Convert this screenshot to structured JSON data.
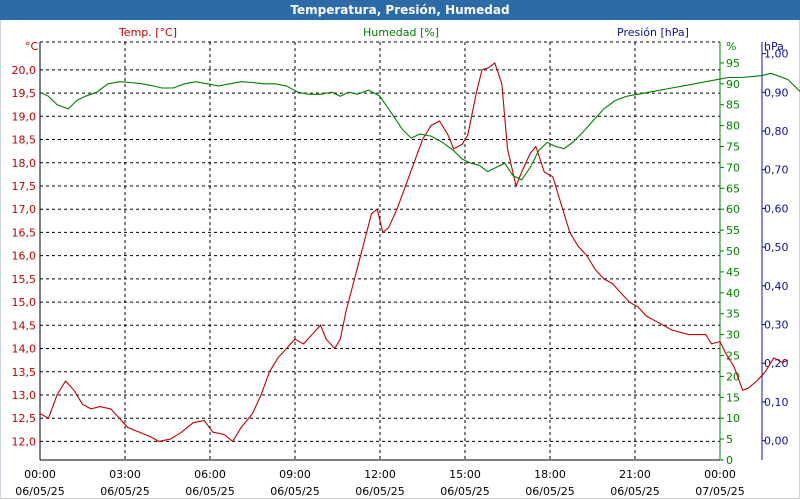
{
  "window": {
    "title": "Temperatura, Presión, Humedad"
  },
  "colors": {
    "temp": "#c00000",
    "hum": "#008000",
    "pres": "#1010a0",
    "grid": "#000000",
    "title_bg": "#2d6aa8"
  },
  "chart_data": {
    "type": "line",
    "grid": true,
    "x_ticks": [
      {
        "time": "00:00",
        "date": "06/05/25"
      },
      {
        "time": "03:00",
        "date": "06/05/25"
      },
      {
        "time": "06:00",
        "date": "06/05/25"
      },
      {
        "time": "09:00",
        "date": "06/05/25"
      },
      {
        "time": "12:00",
        "date": "06/05/25"
      },
      {
        "time": "15:00",
        "date": "06/05/25"
      },
      {
        "time": "18:00",
        "date": "06/05/25"
      },
      {
        "time": "21:00",
        "date": "06/05/25"
      },
      {
        "time": "00:00",
        "date": "07/05/25"
      }
    ],
    "x_range_hours": [
      0,
      24
    ],
    "axes": {
      "temp": {
        "unit": "°C",
        "ylim": [
          11.6,
          20.6
        ],
        "ticks": [
          "12,0",
          "12,5",
          "13,0",
          "13,5",
          "14,0",
          "14,5",
          "15,0",
          "15,5",
          "16,0",
          "16,5",
          "17,0",
          "17,5",
          "18,0",
          "18,5",
          "19,0",
          "19,5",
          "20,0"
        ]
      },
      "hum": {
        "unit": "%",
        "ylim": [
          0,
          100
        ],
        "ticks": [
          "0",
          "5",
          "10",
          "15",
          "20",
          "25",
          "30",
          "35",
          "40",
          "45",
          "50",
          "55",
          "60",
          "65",
          "70",
          "75",
          "80",
          "85",
          "90",
          "95"
        ]
      },
      "pres": {
        "unit": "hPa",
        "ylim": [
          -0.05,
          1.03
        ],
        "ticks": [
          "0,00",
          "0,10",
          "0,20",
          "0,30",
          "0,40",
          "0,50",
          "0,60",
          "0,70",
          "0,80",
          "0,90",
          "1,00"
        ]
      }
    },
    "legend": {
      "temp": "Temp. [°C]",
      "hum": "Humedad [%]",
      "pres": "Presión [hPa]"
    },
    "series": [
      {
        "name": "Temp. [°C]",
        "axis": "temp",
        "points": [
          [
            0,
            12.6
          ],
          [
            0.3,
            12.5
          ],
          [
            0.6,
            13.0
          ],
          [
            0.9,
            13.3
          ],
          [
            1.2,
            13.1
          ],
          [
            1.5,
            12.8
          ],
          [
            1.8,
            12.7
          ],
          [
            2.1,
            12.75
          ],
          [
            2.5,
            12.7
          ],
          [
            2.8,
            12.5
          ],
          [
            3.1,
            12.3
          ],
          [
            3.5,
            12.2
          ],
          [
            3.9,
            12.1
          ],
          [
            4.2,
            12.0
          ],
          [
            4.6,
            12.05
          ],
          [
            5.0,
            12.2
          ],
          [
            5.4,
            12.4
          ],
          [
            5.8,
            12.45
          ],
          [
            6.1,
            12.2
          ],
          [
            6.5,
            12.15
          ],
          [
            6.8,
            12.0
          ],
          [
            7.1,
            12.3
          ],
          [
            7.5,
            12.6
          ],
          [
            7.8,
            13.0
          ],
          [
            8.1,
            13.5
          ],
          [
            8.4,
            13.8
          ],
          [
            8.7,
            14.0
          ],
          [
            9.0,
            14.2
          ],
          [
            9.3,
            14.1
          ],
          [
            9.6,
            14.3
          ],
          [
            9.9,
            14.5
          ],
          [
            10.1,
            14.2
          ],
          [
            10.4,
            14.0
          ],
          [
            10.6,
            14.2
          ],
          [
            10.8,
            14.8
          ],
          [
            11.1,
            15.5
          ],
          [
            11.4,
            16.2
          ],
          [
            11.7,
            16.9
          ],
          [
            11.9,
            17.0
          ],
          [
            12.1,
            16.5
          ],
          [
            12.3,
            16.6
          ],
          [
            12.6,
            17.0
          ],
          [
            12.9,
            17.5
          ],
          [
            13.2,
            18.0
          ],
          [
            13.5,
            18.5
          ],
          [
            13.8,
            18.8
          ],
          [
            14.1,
            18.9
          ],
          [
            14.4,
            18.6
          ],
          [
            14.6,
            18.3
          ],
          [
            14.9,
            18.4
          ],
          [
            15.1,
            18.6
          ],
          [
            15.4,
            19.5
          ],
          [
            15.6,
            20.0
          ],
          [
            15.85,
            20.05
          ],
          [
            16.05,
            20.15
          ],
          [
            16.3,
            19.7
          ],
          [
            16.5,
            18.3
          ],
          [
            16.8,
            17.5
          ],
          [
            17.0,
            17.8
          ],
          [
            17.3,
            18.2
          ],
          [
            17.5,
            18.35
          ],
          [
            17.8,
            17.8
          ],
          [
            18.1,
            17.7
          ],
          [
            18.4,
            17.1
          ],
          [
            18.7,
            16.5
          ],
          [
            19.0,
            16.2
          ],
          [
            19.3,
            16.0
          ],
          [
            19.6,
            15.7
          ],
          [
            19.9,
            15.5
          ],
          [
            20.2,
            15.4
          ],
          [
            20.5,
            15.2
          ],
          [
            20.8,
            15.0
          ],
          [
            21.1,
            14.9
          ],
          [
            21.4,
            14.7
          ],
          [
            21.7,
            14.6
          ],
          [
            22.0,
            14.5
          ],
          [
            22.3,
            14.4
          ],
          [
            22.6,
            14.35
          ],
          [
            22.9,
            14.3
          ],
          [
            23.2,
            14.3
          ],
          [
            23.5,
            14.3
          ],
          [
            23.7,
            14.1
          ],
          [
            24.0,
            14.15
          ],
          [
            24.2,
            13.9
          ],
          [
            24.5,
            13.6
          ],
          [
            24.8,
            13.1
          ],
          [
            25.0,
            13.15
          ],
          [
            25.3,
            13.3
          ],
          [
            25.6,
            13.5
          ],
          [
            25.9,
            13.8
          ],
          [
            26.2,
            13.7
          ],
          [
            26.4,
            13.75
          ]
        ]
      },
      {
        "name": "Humedad [%]",
        "axis": "hum",
        "points": [
          [
            0,
            88
          ],
          [
            0.3,
            87
          ],
          [
            0.6,
            85
          ],
          [
            1.0,
            84
          ],
          [
            1.3,
            86
          ],
          [
            1.6,
            87
          ],
          [
            2.0,
            88
          ],
          [
            2.4,
            90
          ],
          [
            2.8,
            90.5
          ],
          [
            3.2,
            90.3
          ],
          [
            3.6,
            90
          ],
          [
            4.0,
            89.5
          ],
          [
            4.3,
            89
          ],
          [
            4.7,
            89
          ],
          [
            5.1,
            90
          ],
          [
            5.5,
            90.5
          ],
          [
            5.9,
            90
          ],
          [
            6.3,
            89.5
          ],
          [
            6.7,
            90
          ],
          [
            7.1,
            90.5
          ],
          [
            7.5,
            90.3
          ],
          [
            7.9,
            90
          ],
          [
            8.3,
            90
          ],
          [
            8.7,
            89.5
          ],
          [
            9.1,
            88
          ],
          [
            9.5,
            87.5
          ],
          [
            9.9,
            87.5
          ],
          [
            10.3,
            88
          ],
          [
            10.6,
            87
          ],
          [
            10.9,
            88
          ],
          [
            11.2,
            87.5
          ],
          [
            11.6,
            88.5
          ],
          [
            12.0,
            87
          ],
          [
            12.2,
            85
          ],
          [
            12.5,
            82
          ],
          [
            12.8,
            79
          ],
          [
            13.1,
            77
          ],
          [
            13.4,
            78
          ],
          [
            13.8,
            77.5
          ],
          [
            14.2,
            76
          ],
          [
            14.6,
            74
          ],
          [
            14.9,
            72
          ],
          [
            15.2,
            71
          ],
          [
            15.5,
            70.5
          ],
          [
            15.8,
            69
          ],
          [
            16.1,
            70
          ],
          [
            16.4,
            71
          ],
          [
            16.7,
            68
          ],
          [
            17.0,
            67
          ],
          [
            17.3,
            70
          ],
          [
            17.6,
            74
          ],
          [
            17.9,
            76
          ],
          [
            18.2,
            75
          ],
          [
            18.5,
            74.5
          ],
          [
            18.8,
            76
          ],
          [
            19.1,
            78
          ],
          [
            19.5,
            81
          ],
          [
            19.9,
            84
          ],
          [
            20.3,
            86
          ],
          [
            20.7,
            87
          ],
          [
            21.1,
            87.5
          ],
          [
            21.5,
            88
          ],
          [
            21.9,
            88.5
          ],
          [
            22.3,
            89
          ],
          [
            22.7,
            89.5
          ],
          [
            23.1,
            90
          ],
          [
            23.5,
            90.5
          ],
          [
            23.9,
            91
          ],
          [
            24.3,
            91.5
          ],
          [
            24.7,
            91.5
          ],
          [
            25.1,
            91.7
          ],
          [
            25.5,
            92
          ],
          [
            25.8,
            92.5
          ],
          [
            26.1,
            91.8
          ],
          [
            26.4,
            91
          ],
          [
            26.7,
            89
          ],
          [
            27.0,
            87
          ],
          [
            27.3,
            86.2
          ],
          [
            27.6,
            86
          ],
          [
            28.0,
            86.3
          ]
        ]
      }
    ]
  }
}
